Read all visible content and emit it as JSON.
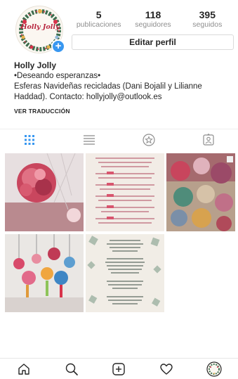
{
  "profile": {
    "logo_text": "Holly Jolly",
    "add_badge": "+",
    "stats": [
      {
        "num": "5",
        "label": "publicaciones"
      },
      {
        "num": "118",
        "label": "seguidores"
      },
      {
        "num": "395",
        "label": "seguidos"
      }
    ],
    "edit_button": "Editar perfil",
    "name": "Holly Jolly",
    "bio_lines": [
      "•Deseando esperanzas•",
      "Esferas Navideñas recicladas (Dani Bojalil y Lilianne",
      "Haddad). Contacto: hollyjolly@outlook.es"
    ],
    "translate": "VER TRADUCCIÓN"
  },
  "tabs": [
    {
      "icon": "grid-icon",
      "active": true
    },
    {
      "icon": "list-icon",
      "active": false
    },
    {
      "icon": "star-icon",
      "active": false
    },
    {
      "icon": "tagged-icon",
      "active": false
    }
  ],
  "posts": [
    {
      "name": "post-1",
      "icon": "pink-ornament-flowers"
    },
    {
      "name": "post-2",
      "icon": "text-card-pink"
    },
    {
      "name": "post-3",
      "icon": "ornaments-box"
    },
    {
      "name": "post-4",
      "icon": "hanging-ornaments"
    },
    {
      "name": "post-5",
      "icon": "text-card-green"
    }
  ],
  "bottom_nav": [
    {
      "icon": "home-icon"
    },
    {
      "icon": "search-icon"
    },
    {
      "icon": "new-post-icon"
    },
    {
      "icon": "heart-icon"
    },
    {
      "icon": "profile-avatar-icon"
    }
  ],
  "colors": {
    "accent": "#3897f0",
    "text": "#262626",
    "muted": "#8e8e8e",
    "border": "#dbdbdb"
  }
}
